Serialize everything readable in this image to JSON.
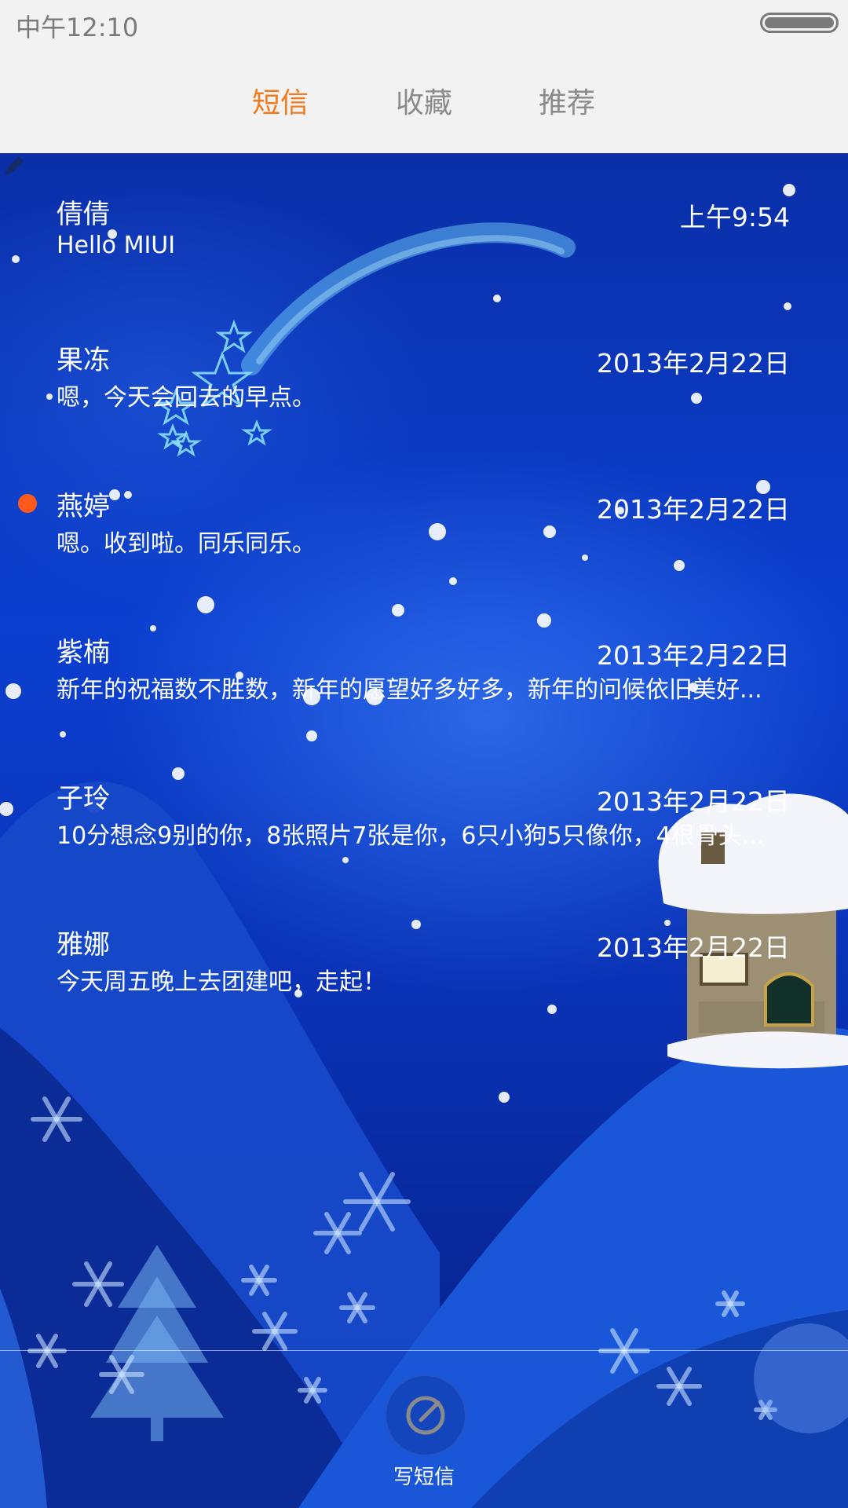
{
  "status_bar": {
    "time": "中午12:10"
  },
  "tabs": [
    {
      "label": "短信",
      "active": true
    },
    {
      "label": "收藏",
      "active": false
    },
    {
      "label": "推荐",
      "active": false
    }
  ],
  "colors": {
    "accent": "#f07a1c",
    "unread": "#ff5a1c",
    "tab_inactive": "#8a8a8a"
  },
  "messages": [
    {
      "name": "倩倩",
      "time": "上午9:54",
      "preview": "Hello MIUI",
      "unread": false,
      "draft": true
    },
    {
      "name": "果冻",
      "time": "2013年2月22日",
      "preview": "嗯，今天会回去的早点。",
      "unread": false
    },
    {
      "name": "燕婷",
      "time": "2013年2月22日",
      "preview": "嗯。收到啦。同乐同乐。",
      "unread": true
    },
    {
      "name": "紫楠",
      "time": "2013年2月22日",
      "preview": "新年的祝福数不胜数，新年的愿望好多好多，新年的问候依旧美好...",
      "unread": false
    },
    {
      "name": "子玲",
      "time": "2013年2月22日",
      "preview": "10分想念9别的你，8张照片7张是你，6只小狗5只像你，4根骨头...",
      "unread": false
    },
    {
      "name": "雅娜",
      "time": "2013年2月22日",
      "preview": "今天周五晚上去团建吧，走起！",
      "unread": false
    }
  ],
  "compose": {
    "label": "写短信",
    "icon": "compose-icon"
  }
}
